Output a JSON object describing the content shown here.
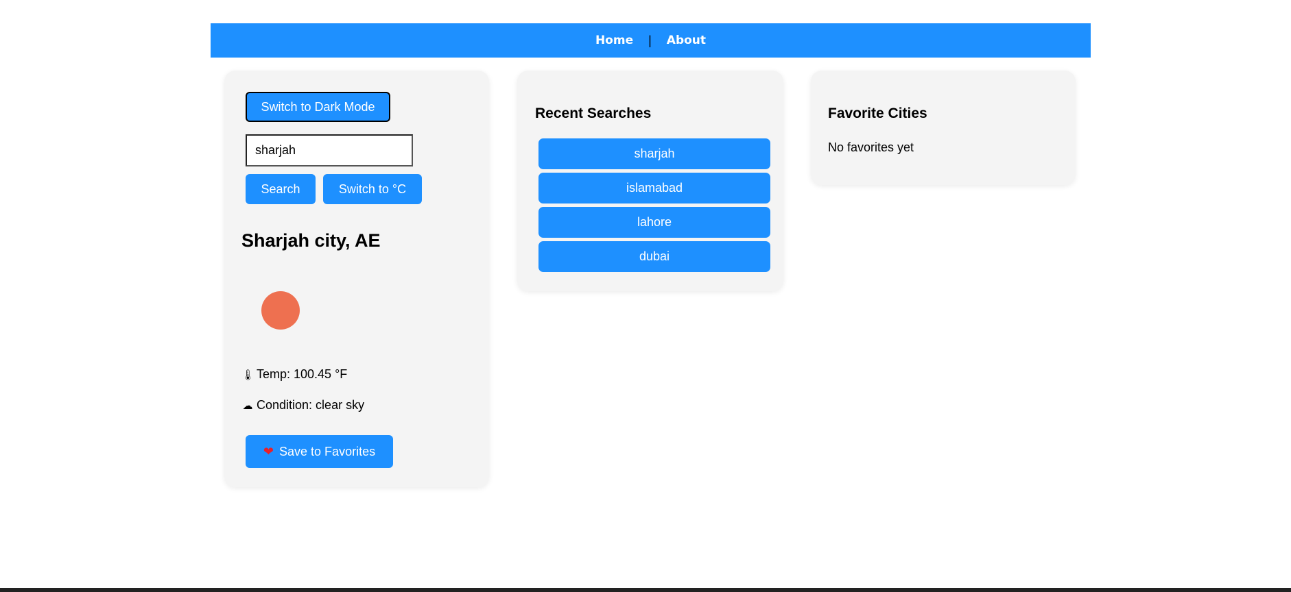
{
  "nav": {
    "home": "Home",
    "separator": "|",
    "about": "About"
  },
  "controls": {
    "dark_mode_label": "Switch to Dark Mode",
    "search_value": "sharjah",
    "search_label": "Search",
    "unit_toggle_label": "Switch to °C"
  },
  "weather": {
    "city": "Sharjah city, AE",
    "icon": "sun-icon",
    "icon_color": "#ee7050",
    "temp_icon": "🌡",
    "temp_text": "Temp: 100.45 °F",
    "condition_icon": "☁",
    "condition_text": "Condition: clear sky",
    "save_heart": "❤",
    "save_label": "Save to Favorites"
  },
  "recent": {
    "title": "Recent Searches",
    "items": [
      {
        "label": "sharjah"
      },
      {
        "label": "islamabad"
      },
      {
        "label": "lahore"
      },
      {
        "label": "dubai"
      }
    ]
  },
  "favorites": {
    "title": "Favorite Cities",
    "empty_text": "No favorites yet"
  },
  "colors": {
    "accent": "#1e90ff",
    "card_bg": "#f4f4f4"
  }
}
